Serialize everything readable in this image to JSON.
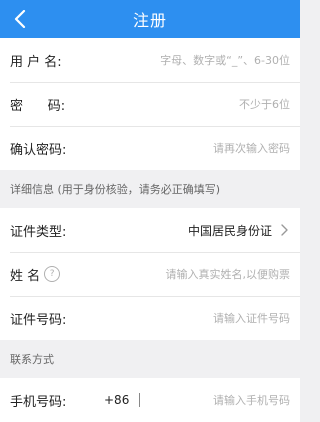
{
  "header": {
    "title": "注册"
  },
  "account": {
    "username": {
      "label": "用 户 名:",
      "placeholder": "字母、数字或“_”、6-30位"
    },
    "password": {
      "label": "密      码:",
      "placeholder": "不少于6位"
    },
    "confirm": {
      "label": "确认密码:",
      "placeholder": "请再次输入密码"
    }
  },
  "details": {
    "section_title": "详细信息 (用于身份核验，请务必正确填写)",
    "id_type": {
      "label": "证件类型:",
      "value": "中国居民身份证"
    },
    "name": {
      "label": "姓 名",
      "help_glyph": "?",
      "placeholder": "请输入真实姓名,以便购票"
    },
    "id_number": {
      "label": "证件号码:",
      "placeholder": "请输入证件号码"
    }
  },
  "contact": {
    "section_title": "联系方式",
    "phone": {
      "label": "手机号码:",
      "prefix": "+86",
      "placeholder": "请输入手机号码"
    }
  },
  "colors": {
    "accent": "#2d8ff0",
    "page_bg": "#f0f0f2"
  },
  "icons": {
    "back": "chevron-left-icon",
    "select": "chevron-right-icon",
    "help": "question-circle-icon"
  }
}
